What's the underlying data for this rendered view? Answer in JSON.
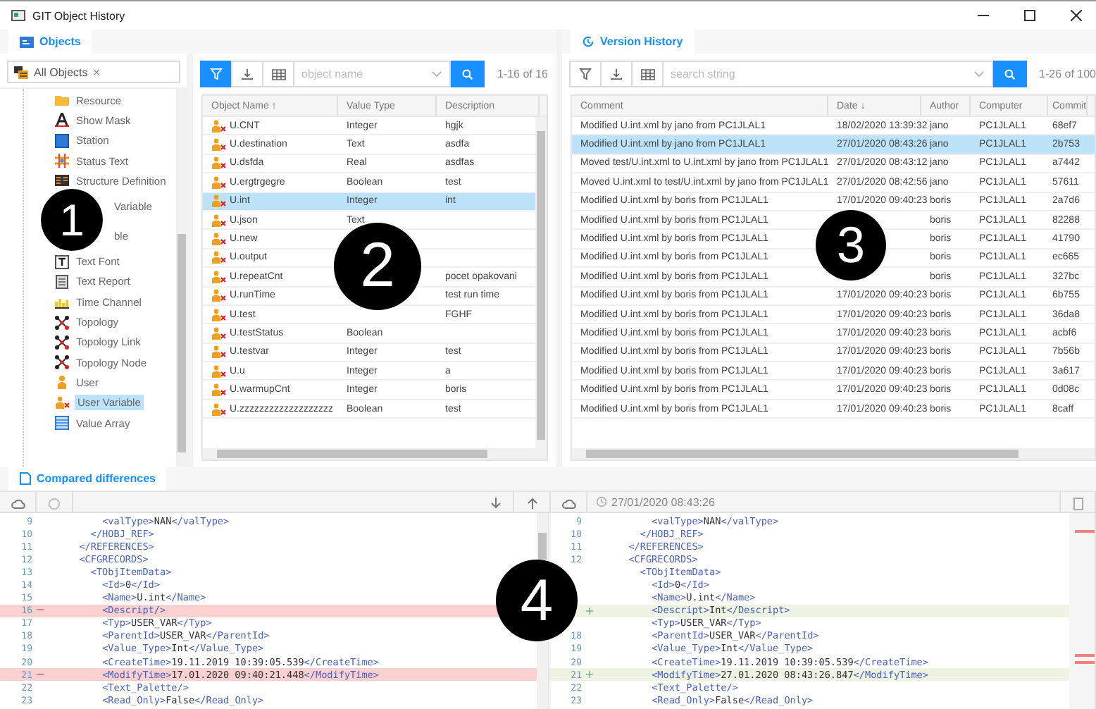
{
  "window": {
    "title": "GIT Object History"
  },
  "objects_panel": {
    "tab": {
      "label": "Objects",
      "selected": true
    },
    "filter_chip": {
      "label": "All Objects",
      "remove": "×"
    },
    "tree": [
      {
        "label": "Resource",
        "kind": "folder",
        "selected": false
      },
      {
        "label": "Show Mask",
        "kind": "mask",
        "selected": false
      },
      {
        "label": "Station",
        "kind": "station",
        "selected": false
      },
      {
        "label": "Status Text",
        "kind": "status",
        "selected": false
      },
      {
        "label": "Structure Definition",
        "kind": "structure",
        "selected": false
      },
      {
        "label": "Variable",
        "kind": "obscured",
        "selected": false
      },
      {
        "label": "ble",
        "kind": "obscured",
        "selected": false
      },
      {
        "label": "Text Font",
        "kind": "font",
        "selected": false
      },
      {
        "label": "Text Report",
        "kind": "report",
        "selected": false
      },
      {
        "label": "Time Channel",
        "kind": "channel",
        "selected": false
      },
      {
        "label": "Topology",
        "kind": "topology",
        "selected": false
      },
      {
        "label": "Topology Link",
        "kind": "topology",
        "selected": false
      },
      {
        "label": "Topology Node",
        "kind": "topology",
        "selected": false
      },
      {
        "label": "User",
        "kind": "user",
        "selected": false
      },
      {
        "label": "User Variable",
        "kind": "uservar",
        "selected": true
      },
      {
        "label": "Value Array",
        "kind": "array",
        "selected": false
      }
    ],
    "toolbar": {
      "filter_active": true,
      "placeholder": "object name",
      "count": "1-16 of 16"
    },
    "columns": [
      "Object Name ↑",
      "Value Type",
      "Description"
    ],
    "rows": [
      {
        "name": "U.CNT",
        "value_type": "Integer",
        "description": "hgjk",
        "selected": false
      },
      {
        "name": "U.destination",
        "value_type": "Text",
        "description": "asdfa",
        "selected": false
      },
      {
        "name": "U.dsfda",
        "value_type": "Real",
        "description": "asdfas",
        "selected": false
      },
      {
        "name": "U.ergtrgegre",
        "value_type": "Boolean",
        "description": "test",
        "selected": false
      },
      {
        "name": "U.int",
        "value_type": "Integer",
        "description": "int",
        "selected": true
      },
      {
        "name": "U.json",
        "value_type": "Text",
        "selected": false
      },
      {
        "name": "U.new",
        "selected": false
      },
      {
        "name": "U.output",
        "selected": false
      },
      {
        "name": "U.repeatCnt",
        "description": "pocet opakovani",
        "selected": false
      },
      {
        "name": "U.runTime",
        "description": "test run time",
        "selected": false
      },
      {
        "name": "U.test",
        "description": "FGHF",
        "selected": false
      },
      {
        "name": "U.testStatus",
        "value_type": "Boolean",
        "selected": false
      },
      {
        "name": "U.testvar",
        "value_type": "Integer",
        "description": "test",
        "selected": false
      },
      {
        "name": "U.u",
        "value_type": "Integer",
        "description": "a",
        "selected": false
      },
      {
        "name": "U.warmupCnt",
        "value_type": "Integer",
        "description": "boris",
        "selected": false
      },
      {
        "name": "U.zzzzzzzzzzzzzzzzzzz",
        "value_type": "Boolean",
        "description": "test",
        "selected": false
      }
    ],
    "callout": "1",
    "grid_callout": "2"
  },
  "version_panel": {
    "tab": {
      "label": "Version History",
      "selected": true
    },
    "toolbar": {
      "filter_active": false,
      "placeholder": "search string",
      "count": "1-26 of 100"
    },
    "columns": [
      "Comment",
      "Date ↓",
      "Author",
      "Computer",
      "Commit"
    ],
    "rows": [
      {
        "comment": "Modified U.int.xml by jano from PC1JLAL1",
        "date": "18/02/2020 13:39:32",
        "author": "jano",
        "computer": "PC1JLAL1",
        "commit": "68ef7",
        "selected": false
      },
      {
        "comment": "Modified U.int.xml by jano from PC1JLAL1",
        "date": "27/01/2020 08:43:26",
        "author": "jano",
        "computer": "PC1JLAL1",
        "commit": "2b753",
        "selected": true
      },
      {
        "comment": "Moved test/U.int.xml to U.int.xml by jano from PC1JLAL1",
        "date": "27/01/2020 08:43:12",
        "author": "jano",
        "computer": "PC1JLAL1",
        "commit": "a7442",
        "selected": false
      },
      {
        "comment": "Moved U.int.xml to test/U.int.xml by jano from PC1JLAL1",
        "date": "27/01/2020 08:42:56",
        "author": "jano",
        "computer": "PC1JLAL1",
        "commit": "57611",
        "selected": false
      },
      {
        "comment": "Modified U.int.xml by boris from PC1JLAL1",
        "date": "17/01/2020 09:40:23",
        "author": "boris",
        "computer": "PC1JLAL1",
        "commit": "2a7d6",
        "selected": false
      },
      {
        "comment": "Modified U.int.xml by boris from PC1JLAL1",
        "author": "boris",
        "computer": "PC1JLAL1",
        "commit": "82288",
        "selected": false
      },
      {
        "comment": "Modified U.int.xml by boris from PC1JLAL1",
        "author": "boris",
        "computer": "PC1JLAL1",
        "commit": "41790",
        "selected": false
      },
      {
        "comment": "Modified U.int.xml by boris from PC1JLAL1",
        "author": "boris",
        "computer": "PC1JLAL1",
        "commit": "ec665",
        "selected": false
      },
      {
        "comment": "Modified U.int.xml by boris from PC1JLAL1",
        "author": "boris",
        "computer": "PC1JLAL1",
        "commit": "327bc",
        "selected": false
      },
      {
        "comment": "Modified U.int.xml by boris from PC1JLAL1",
        "date": "17/01/2020 09:40:23",
        "author": "boris",
        "computer": "PC1JLAL1",
        "commit": "6b755",
        "selected": false
      },
      {
        "comment": "Modified U.int.xml by boris from PC1JLAL1",
        "date": "17/01/2020 09:40:23",
        "author": "boris",
        "computer": "PC1JLAL1",
        "commit": "36da8",
        "selected": false
      },
      {
        "comment": "Modified U.int.xml by boris from PC1JLAL1",
        "date": "17/01/2020 09:40:23",
        "author": "boris",
        "computer": "PC1JLAL1",
        "commit": "acbf6",
        "selected": false
      },
      {
        "comment": "Modified U.int.xml by boris from PC1JLAL1",
        "date": "17/01/2020 09:40:23",
        "author": "boris",
        "computer": "PC1JLAL1",
        "commit": "7b56b",
        "selected": false
      },
      {
        "comment": "Modified U.int.xml by boris from PC1JLAL1",
        "date": "17/01/2020 09:40:23",
        "author": "boris",
        "computer": "PC1JLAL1",
        "commit": "3a617",
        "selected": false
      },
      {
        "comment": "Modified U.int.xml by boris from PC1JLAL1",
        "date": "17/01/2020 09:40:23",
        "author": "boris",
        "computer": "PC1JLAL1",
        "commit": "0d08c",
        "selected": false
      },
      {
        "comment": "Modified U.int.xml by boris from PC1JLAL1",
        "date": "17/01/2020 09:40:23",
        "author": "boris",
        "computer": "PC1JLAL1",
        "commit": "8caff",
        "selected": false
      }
    ],
    "callout": "3"
  },
  "diff_panel": {
    "tab": {
      "label": "Compared differences",
      "selected": true
    },
    "right_timestamp_x": "27/01/2020 08:43:26",
    "callout": "4",
    "left_lines": [
      {
        "num": "9",
        "text": "      <valType>NAN</valType>",
        "kind": "same"
      },
      {
        "num": "10",
        "text": "    </HOBJ_REF>",
        "kind": "same"
      },
      {
        "num": "11",
        "text": "  </REFERENCES>",
        "kind": "same"
      },
      {
        "num": "12",
        "text": "  <CFGRECORDS>",
        "kind": "same"
      },
      {
        "num": "13",
        "text": "    <TObjItemData>",
        "kind": "same"
      },
      {
        "num": "14",
        "text": "      <Id>0</Id>",
        "kind": "same"
      },
      {
        "num": "15",
        "text": "      <Name>U.int</Name>",
        "kind": "same"
      },
      {
        "num": "16",
        "text": "      <Descript/>",
        "kind": "removed"
      },
      {
        "num": "17",
        "text": "      <Typ>USER_VAR</Typ>",
        "kind": "same"
      },
      {
        "num": "18",
        "text": "      <ParentId>USER_VAR</ParentId>",
        "kind": "same"
      },
      {
        "num": "19",
        "text": "      <Value_Type>Int</Value_Type>",
        "kind": "same"
      },
      {
        "num": "20",
        "text": "      <CreateTime>19.11.2019 10:39:05.539</CreateTime>",
        "kind": "same"
      },
      {
        "num": "21",
        "text": "      <ModifyTime>17.01.2020 09:40:21.448</ModifyTime>",
        "kind": "removed"
      },
      {
        "num": "22",
        "text": "      <Text_Palette/>",
        "kind": "same"
      },
      {
        "num": "23",
        "text": "      <Read_Only>False</Read_Only>",
        "kind": "same"
      }
    ],
    "right_lines": [
      {
        "num": "9",
        "text": "      <valType>NAN</valType>",
        "kind": "same"
      },
      {
        "num": "10",
        "text": "    </HOBJ_REF>",
        "kind": "same"
      },
      {
        "num": "11",
        "text": "  </REFERENCES>",
        "kind": "same"
      },
      {
        "num": "12",
        "text": "  <CFGRECORDS>",
        "kind": "same"
      },
      {
        "text": "    <TObjItemData>",
        "kind": "same"
      },
      {
        "text": "      <Id>0</Id>",
        "kind": "same"
      },
      {
        "text": "      <Name>U.int</Name>",
        "kind": "same"
      },
      {
        "text": "      <Descript>Int</Descript>",
        "kind": "added"
      },
      {
        "text": "      <Typ>USER_VAR</Typ>",
        "kind": "same"
      },
      {
        "num": "18",
        "text": "      <ParentId>USER_VAR</ParentId>",
        "kind": "same"
      },
      {
        "num": "19",
        "text": "      <Value_Type>Int</Value_Type>",
        "kind": "same"
      },
      {
        "num": "20",
        "text": "      <CreateTime>19.11.2019 10:39:05.539</CreateTime>",
        "kind": "same"
      },
      {
        "num": "21",
        "text": "      <ModifyTime>27.01.2020 08:43:26.847</ModifyTime>",
        "kind": "added"
      },
      {
        "num": "22",
        "text": "      <Text_Palette/>",
        "kind": "same"
      },
      {
        "num": "23",
        "text": "      <Read_Only>False</Read_Only>",
        "kind": "same"
      }
    ]
  }
}
